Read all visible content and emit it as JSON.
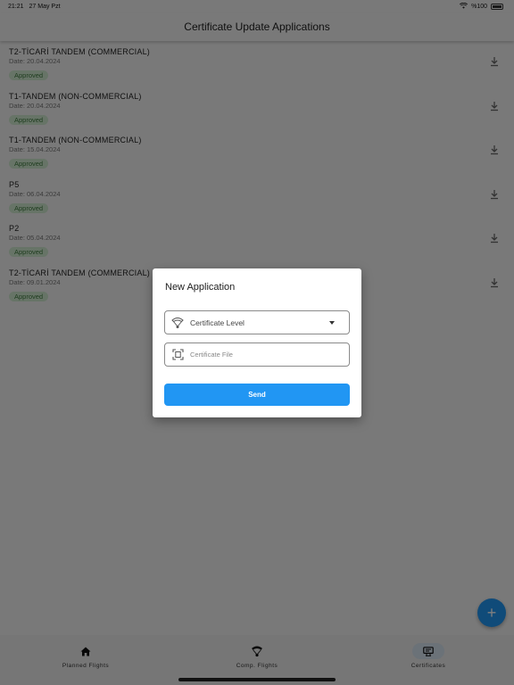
{
  "status_bar": {
    "time": "21:21",
    "date": "27 May Pzt",
    "battery": "%100"
  },
  "app_bar": {
    "title": "Certificate Update Applications"
  },
  "applications": [
    {
      "title": "T2-TİCARİ TANDEM (COMMERCIAL)",
      "date": "Date: 20.04.2024",
      "status": "Approved"
    },
    {
      "title": "T1-TANDEM (NON-COMMERCIAL)",
      "date": "Date: 20.04.2024",
      "status": "Approved"
    },
    {
      "title": "T1-TANDEM (NON-COMMERCIAL)",
      "date": "Date: 15.04.2024",
      "status": "Approved"
    },
    {
      "title": "P5",
      "date": "Date: 06.04.2024",
      "status": "Approved"
    },
    {
      "title": "P2",
      "date": "Date: 05.04.2024",
      "status": "Approved"
    },
    {
      "title": "T2-TİCARİ TANDEM (COMMERCIAL)",
      "date": "Date: 09.01.2024",
      "status": "Approved"
    }
  ],
  "dialog": {
    "title": "New Application",
    "level_label": "Certificate Level",
    "file_placeholder": "Certificate File",
    "send_label": "Send"
  },
  "fab": {
    "icon": "plus-icon",
    "label": "+"
  },
  "bottom_nav": {
    "items": [
      {
        "label": "Planned Flights",
        "icon": "home-icon"
      },
      {
        "label": "Comp. Flights",
        "icon": "paraglider-icon"
      },
      {
        "label": "Certificates",
        "icon": "certificate-icon",
        "active": true
      }
    ]
  },
  "colors": {
    "accent": "#2196f3",
    "badge_bg": "#cfe8cf",
    "badge_text": "#3d7a3d",
    "background": "#f3f3f3"
  }
}
